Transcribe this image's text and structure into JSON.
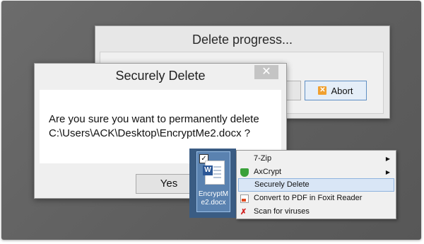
{
  "progress_dialog": {
    "title": "Delete progress...",
    "abort_label": "Abort"
  },
  "secure_dialog": {
    "title": "Securely Delete",
    "close_glyph": "✕",
    "message_line1": "Are you sure you want to permanently delete",
    "message_line2": "C:\\Users\\ACK\\Desktop\\EncryptMe2.docx ?",
    "yes_label": "Yes"
  },
  "file": {
    "name": "EncryptMe2.docx",
    "icon": "word-document-icon",
    "checked": true
  },
  "context_menu": {
    "items": [
      {
        "label": "7-Zip",
        "submenu": true,
        "icon": "none"
      },
      {
        "label": "AxCrypt",
        "submenu": true,
        "icon": "green-shield-icon"
      },
      {
        "label": "Securely Delete",
        "submenu": false,
        "highlighted": true,
        "icon": "none"
      },
      {
        "label": "Convert to PDF in Foxit Reader",
        "submenu": false,
        "icon": "pdf-icon"
      },
      {
        "label": "Scan for viruses",
        "submenu": false,
        "icon": "virus-scan-icon"
      }
    ]
  },
  "colors": {
    "backdrop": "#666666",
    "highlight": "#d9e6f6",
    "accent_border": "#5f8fc4"
  }
}
